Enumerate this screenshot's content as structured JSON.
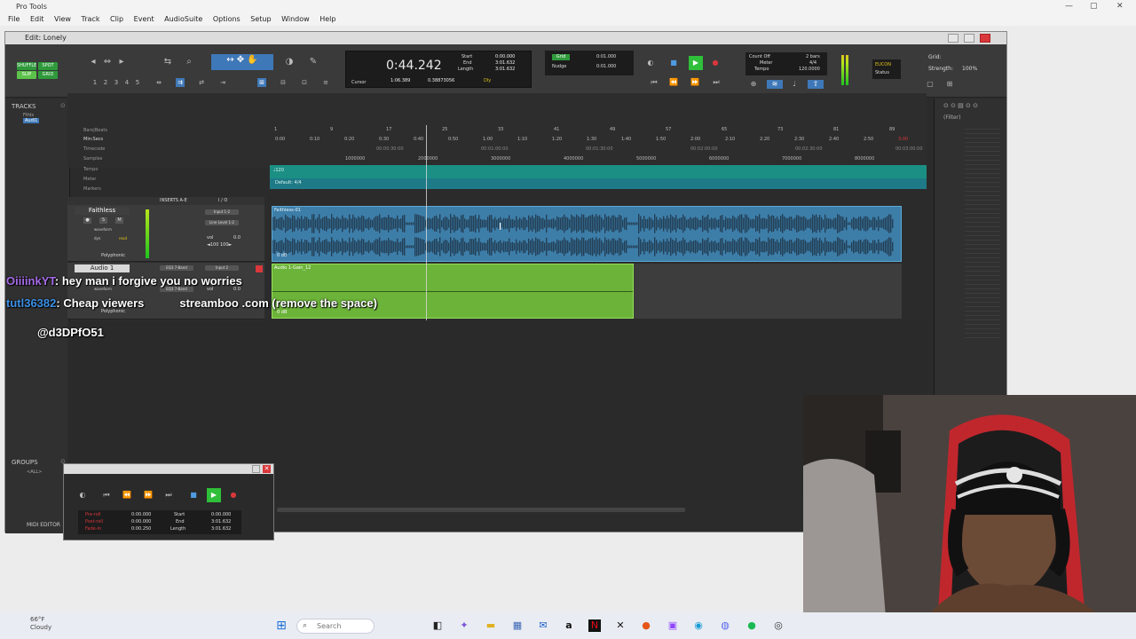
{
  "os": {
    "app_title": "Pro Tools",
    "menu": [
      "File",
      "Edit",
      "View",
      "Track",
      "Clip",
      "Event",
      "AudioSuite",
      "Options",
      "Setup",
      "Window",
      "Help"
    ]
  },
  "edit_window": {
    "title": "Edit: Lonely",
    "modes": {
      "shuffle": "SHUFFLE",
      "spot": "SPOT",
      "slip": "SLIP",
      "grid": "GRID"
    },
    "counter": {
      "main": "0:44.242",
      "start_label": "Start",
      "start": "0:00.000",
      "end_label": "End",
      "end": "3:01.632",
      "length_label": "Length",
      "length": "3:01.632",
      "cursor_label": "Cursor",
      "cursor": "1:06.389",
      "cursor_sample": "0.38873056",
      "dly": "Dly"
    },
    "grid": {
      "grid_label": "Grid",
      "grid_value": "0:01.000",
      "nudge_label": "Nudge",
      "nudge_value": "0:01.000"
    },
    "tempo_box": {
      "count_off": "Count Off",
      "bars": "2 bars",
      "meter": "Meter",
      "meter_val": "4/4",
      "tempo": "Tempo",
      "tempo_val": "120.0000"
    },
    "eucon": {
      "label": "EUCON",
      "status": "Status"
    },
    "grid_strength": {
      "grid": "Grid:",
      "strength": "Strength:",
      "strength_val": "100%"
    },
    "tracks_pane_title": "TRACKS",
    "groups_pane_title": "GROUPS",
    "group_item": "<ALL>",
    "track_list": [
      "Fthls",
      "Audi1"
    ],
    "filter_label": "(Filter)",
    "midi_editor": "MIDI EDITOR"
  },
  "rulers": {
    "labels": [
      "Bars|Beats",
      "Min:Secs",
      "Timecode",
      "Samples",
      "Tempo",
      "Meter",
      "Markers"
    ],
    "bars": [
      "1",
      "9",
      "17",
      "25",
      "33",
      "41",
      "49",
      "57",
      "65",
      "73",
      "81",
      "89"
    ],
    "minsecs": [
      "0:00",
      "0:10",
      "0:20",
      "0:30",
      "0:40",
      "0:50",
      "1:00",
      "1:10",
      "1:20",
      "1:30",
      "1:40",
      "1:50",
      "2:00",
      "2:10",
      "2:20",
      "2:30",
      "2:40",
      "2:50",
      "3:00"
    ],
    "timecode": [
      "00:00:30:00",
      "00:01:00:00",
      "00:01:30:00",
      "00:02:00:00",
      "00:02:30:00",
      "00:03:00:00"
    ],
    "samples": [
      "1000000",
      "2000000",
      "3000000",
      "4000000",
      "5000000",
      "6000000",
      "7000000",
      "8000000"
    ],
    "tempo_lane": "♩120",
    "meter_lane": "Default: 4/4"
  },
  "track_headers": {
    "inserts": "INSERTS A-E",
    "io": "I / O"
  },
  "tracks": [
    {
      "name": "Faithless",
      "input": "Input 1-2",
      "output": "Line Level 1-2",
      "vol_label": "vol",
      "vol": "0.0",
      "pan": "◄100  100►",
      "view": "waveform",
      "auto": "dyn",
      "mode": "read",
      "playlist": "Polyphonic",
      "clip": "Faithless-01",
      "gain": "0 dB"
    },
    {
      "name": "Audio 1",
      "insert": "EQ3 7-Band",
      "input": "Input 2",
      "output": "EQ3 7-Band",
      "vol_label": "vol",
      "vol": "0.0",
      "view": "waveform",
      "playlist": "Polyphonic",
      "clip": "Audio 1-Gain_12",
      "gain": "0 dB"
    }
  ],
  "chat": [
    {
      "user": "OiiiinkYT",
      "message": ": hey man i forgive you no worries"
    },
    {
      "user": "tutl36382",
      "message": ": Cheap viewers",
      "extra": "streamboo .com (remove the space)"
    },
    {
      "user": "",
      "message": "@d3DPfO51"
    }
  ],
  "transport_window": {
    "pre_roll_label": "Pre-roll",
    "pre_roll": "0:00.000",
    "post_roll_label": "Post-roll",
    "post_roll": "0:00.000",
    "fade_in_label": "Fade-in",
    "fade_in": "0:00.250",
    "start_label": "Start",
    "start": "0:00.000",
    "end_label": "End",
    "end": "3:01.632",
    "length_label": "Length",
    "length": "3:01.632"
  },
  "taskbar": {
    "weather_temp": "66°F",
    "weather_desc": "Cloudy",
    "search_placeholder": "Search"
  },
  "colors": {
    "faithless_clip": "#3d7ea9",
    "audio1_clip": "#6cb33a",
    "tempo_lane": "#1b8f84",
    "play_green": "#2fbf3a",
    "record_red": "#d9373b"
  }
}
